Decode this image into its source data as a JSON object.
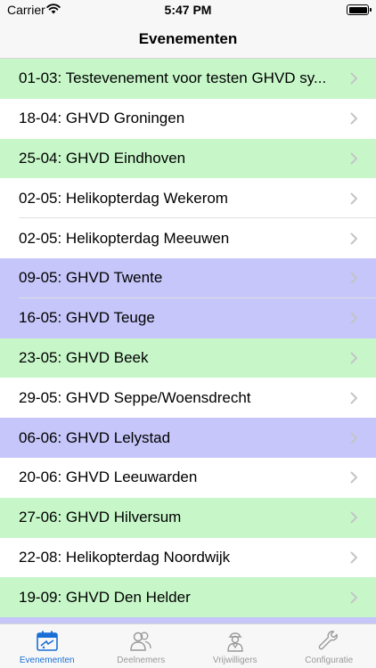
{
  "status_bar": {
    "carrier": "Carrier",
    "time": "5:47 PM",
    "wifi_icon": "wifi-icon",
    "battery_icon": "battery-icon"
  },
  "nav": {
    "title": "Evenementen"
  },
  "colors": {
    "green": "#c7f7c9",
    "purple": "#c6c6fa",
    "white": "#ffffff",
    "chevron": "#c4c4c7",
    "tab_active": "#1a6fd6",
    "tab_inactive": "#999999"
  },
  "events": [
    {
      "label": "01-03: Testevenement voor testen GHVD sy...",
      "color": "green"
    },
    {
      "label": "18-04: GHVD Groningen",
      "color": "white"
    },
    {
      "label": "25-04: GHVD Eindhoven",
      "color": "green"
    },
    {
      "label": "02-05: Helikopterdag Wekerom",
      "color": "white"
    },
    {
      "label": "02-05: Helikopterdag Meeuwen",
      "color": "white"
    },
    {
      "label": "09-05: GHVD Twente",
      "color": "purple"
    },
    {
      "label": "16-05: GHVD Teuge",
      "color": "purple"
    },
    {
      "label": "23-05: GHVD Beek",
      "color": "green"
    },
    {
      "label": "29-05: GHVD Seppe/Woensdrecht",
      "color": "white"
    },
    {
      "label": "06-06: GHVD Lelystad",
      "color": "purple"
    },
    {
      "label": "20-06: GHVD Leeuwarden",
      "color": "white"
    },
    {
      "label": "27-06: GHVD Hilversum",
      "color": "green"
    },
    {
      "label": "22-08: Helikopterdag Noordwijk",
      "color": "white"
    },
    {
      "label": "19-09: GHVD Den Helder",
      "color": "green"
    },
    {
      "label": "",
      "color": "purple"
    }
  ],
  "tabs": [
    {
      "label": "Evenementen",
      "icon": "calendar-icon",
      "active": true
    },
    {
      "label": "Deelnemers",
      "icon": "people-icon",
      "active": false
    },
    {
      "label": "Vrijwilligers",
      "icon": "volunteer-icon",
      "active": false
    },
    {
      "label": "Configuratie",
      "icon": "wrench-icon",
      "active": false
    }
  ]
}
